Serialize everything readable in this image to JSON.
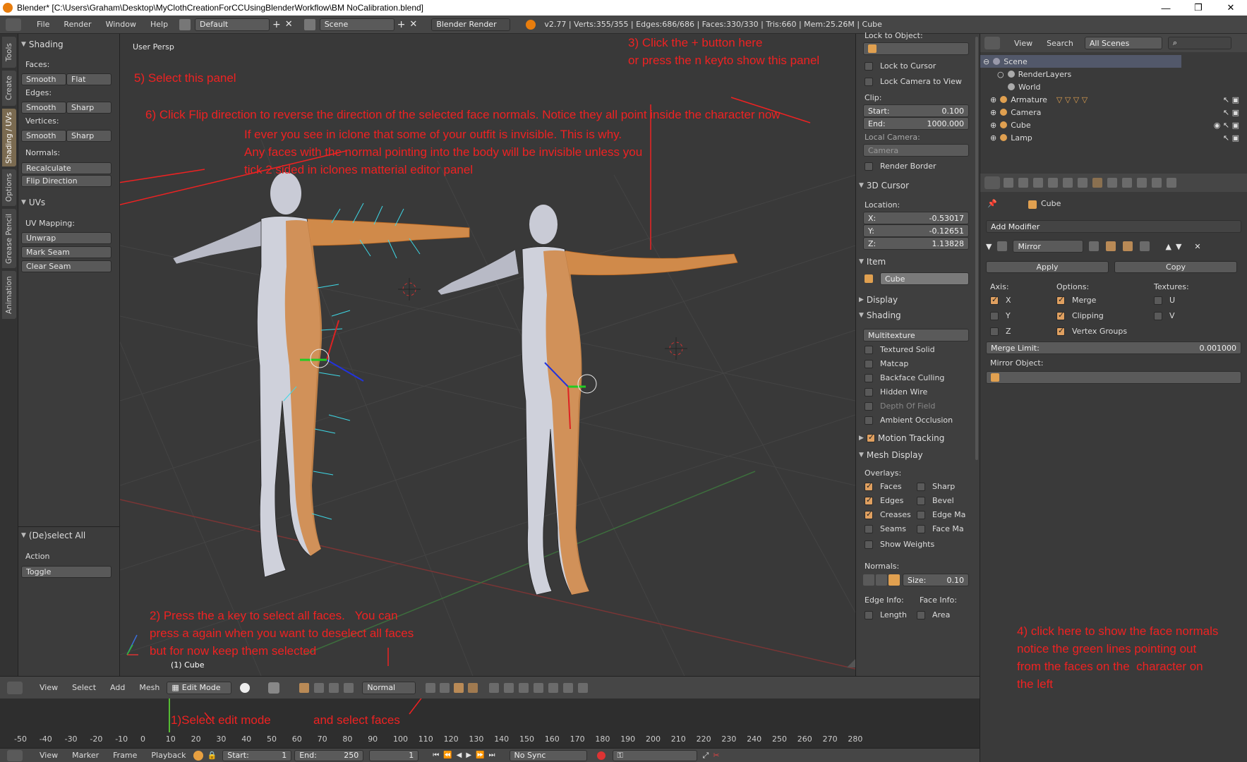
{
  "window_title": "Blender* [C:\\Users\\Graham\\Desktop\\MyClothCreationForCCUsingBlenderWorkflow\\BM NoCalibration.blend]",
  "menu": [
    "File",
    "Render",
    "Window",
    "Help"
  ],
  "layout_field": "Default",
  "scene_field": "Scene",
  "render_engine": "Blender Render",
  "stats": "v2.77 | Verts:355/355 | Edges:686/686 | Faces:330/330 | Tris:660 | Mem:25.26M | Cube",
  "left_tabs": [
    "Tools",
    "Create",
    "Shading / UVs",
    "Options",
    "Grease Pencil",
    "Animation"
  ],
  "toolshelf": {
    "shading_title": "Shading",
    "faces_label": "Faces:",
    "smooth": "Smooth",
    "flat": "Flat",
    "edges_label": "Edges:",
    "sharp": "Sharp",
    "vertices_label": "Vertices:",
    "normals_label": "Normals:",
    "recalculate": "Recalculate",
    "flip_direction": "Flip Direction",
    "uvs_title": "UVs",
    "uv_mapping_label": "UV Mapping:",
    "unwrap": "Unwrap",
    "mark_seam": "Mark Seam",
    "clear_seam": "Clear Seam",
    "deselect_title": "(De)select All",
    "action_label": "Action",
    "action_value": "Toggle"
  },
  "viewport": {
    "label": "User Persp",
    "object_label": "(1) Cube"
  },
  "annotations": {
    "a1": "1)Select edit mode",
    "a1b": "and select faces",
    "a2": "2) Press the a key to select all faces.   You can\npress a again when you want to deselect all faces\nbut for now keep them selected",
    "a3": "3) Click the + button here\nor press the n keyto show this panel",
    "a4": "4) click here to show the face normals\nnotice the green lines pointing out\nfrom the faces on the  character on\nthe left",
    "a5": "5) Select this panel",
    "a6": "6) Click Flip direction to reverse the direction of the selected face normals. Notice they all point inside the character now",
    "a6b": "If ever you see in iclone that some of your outfit is invisible. This is why.\nAny faces with the normal pointing into the body will be invisible unless you\ntick 2 sided in iclones matterial editor panel"
  },
  "npanel": {
    "lock_to_object": "Lock to Object:",
    "lock_to_cursor": "Lock to Cursor",
    "lock_camera": "Lock Camera to View",
    "clip": "Clip:",
    "clip_start_label": "Start:",
    "clip_start": "0.100",
    "clip_end_label": "End:",
    "clip_end": "1000.000",
    "local_camera": "Local Camera:",
    "camera_field": "Camera",
    "render_border": "Render Border",
    "cursor_title": "3D Cursor",
    "location": "Location:",
    "x_label": "X:",
    "x": "-0.53017",
    "y_label": "Y:",
    "y": "-0.12651",
    "z_label": "Z:",
    "z": "1.13828",
    "item_title": "Item",
    "item_name": "Cube",
    "display_title": "Display",
    "shading_title": "Shading",
    "shading_mode": "Multitexture",
    "textured_solid": "Textured Solid",
    "matcap": "Matcap",
    "backface": "Backface Culling",
    "hidden_wire": "Hidden Wire",
    "depth_of_field": "Depth Of Field",
    "ambient_occlusion": "Ambient Occlusion",
    "motion_tracking": "Motion Tracking",
    "mesh_display": "Mesh Display",
    "overlays": "Overlays:",
    "faces": "Faces",
    "sharp": "Sharp",
    "edges": "Edges",
    "bevel": "Bevel",
    "creases": "Creases",
    "edge_ma": "Edge Ma",
    "seams": "Seams",
    "face_ma": "Face Ma",
    "show_weights": "Show Weights",
    "normals": "Normals:",
    "size_label": "Size:",
    "size": "0.10",
    "edge_info": "Edge Info:",
    "face_info": "Face Info:",
    "length": "Length",
    "area": "Area"
  },
  "outliner": {
    "menu": [
      "View",
      "Search"
    ],
    "filter": "All Scenes",
    "items": [
      "Scene",
      "RenderLayers",
      "World",
      "Armature",
      "Camera",
      "Cube",
      "Lamp"
    ]
  },
  "properties": {
    "object_name": "Cube",
    "add_modifier": "Add Modifier",
    "modifier_name": "Mirror",
    "apply": "Apply",
    "copy": "Copy",
    "axis": "Axis:",
    "options": "Options:",
    "textures": "Textures:",
    "x": "X",
    "y": "Y",
    "z": "Z",
    "merge": "Merge",
    "clipping": "Clipping",
    "vertex_groups": "Vertex Groups",
    "u": "U",
    "v": "V",
    "merge_limit_label": "Merge Limit:",
    "merge_limit": "0.001000",
    "mirror_object": "Mirror Object:"
  },
  "vp_header": {
    "menu": [
      "View",
      "Select",
      "Add",
      "Mesh"
    ],
    "mode": "Edit Mode",
    "pivot": "Normal"
  },
  "timeline": {
    "ticks": [
      "-50",
      "-40",
      "-30",
      "-20",
      "-10",
      "0",
      "10",
      "20",
      "30",
      "40",
      "50",
      "60",
      "70",
      "80",
      "90",
      "100",
      "110",
      "120",
      "130",
      "140",
      "150",
      "160",
      "170",
      "180",
      "190",
      "200",
      "210",
      "220",
      "230",
      "240",
      "250",
      "260",
      "270",
      "280"
    ],
    "menu": [
      "View",
      "Marker",
      "Frame",
      "Playback"
    ],
    "start_label": "Start:",
    "start": "1",
    "end_label": "End:",
    "end": "250",
    "current": "1",
    "sync": "No Sync"
  }
}
